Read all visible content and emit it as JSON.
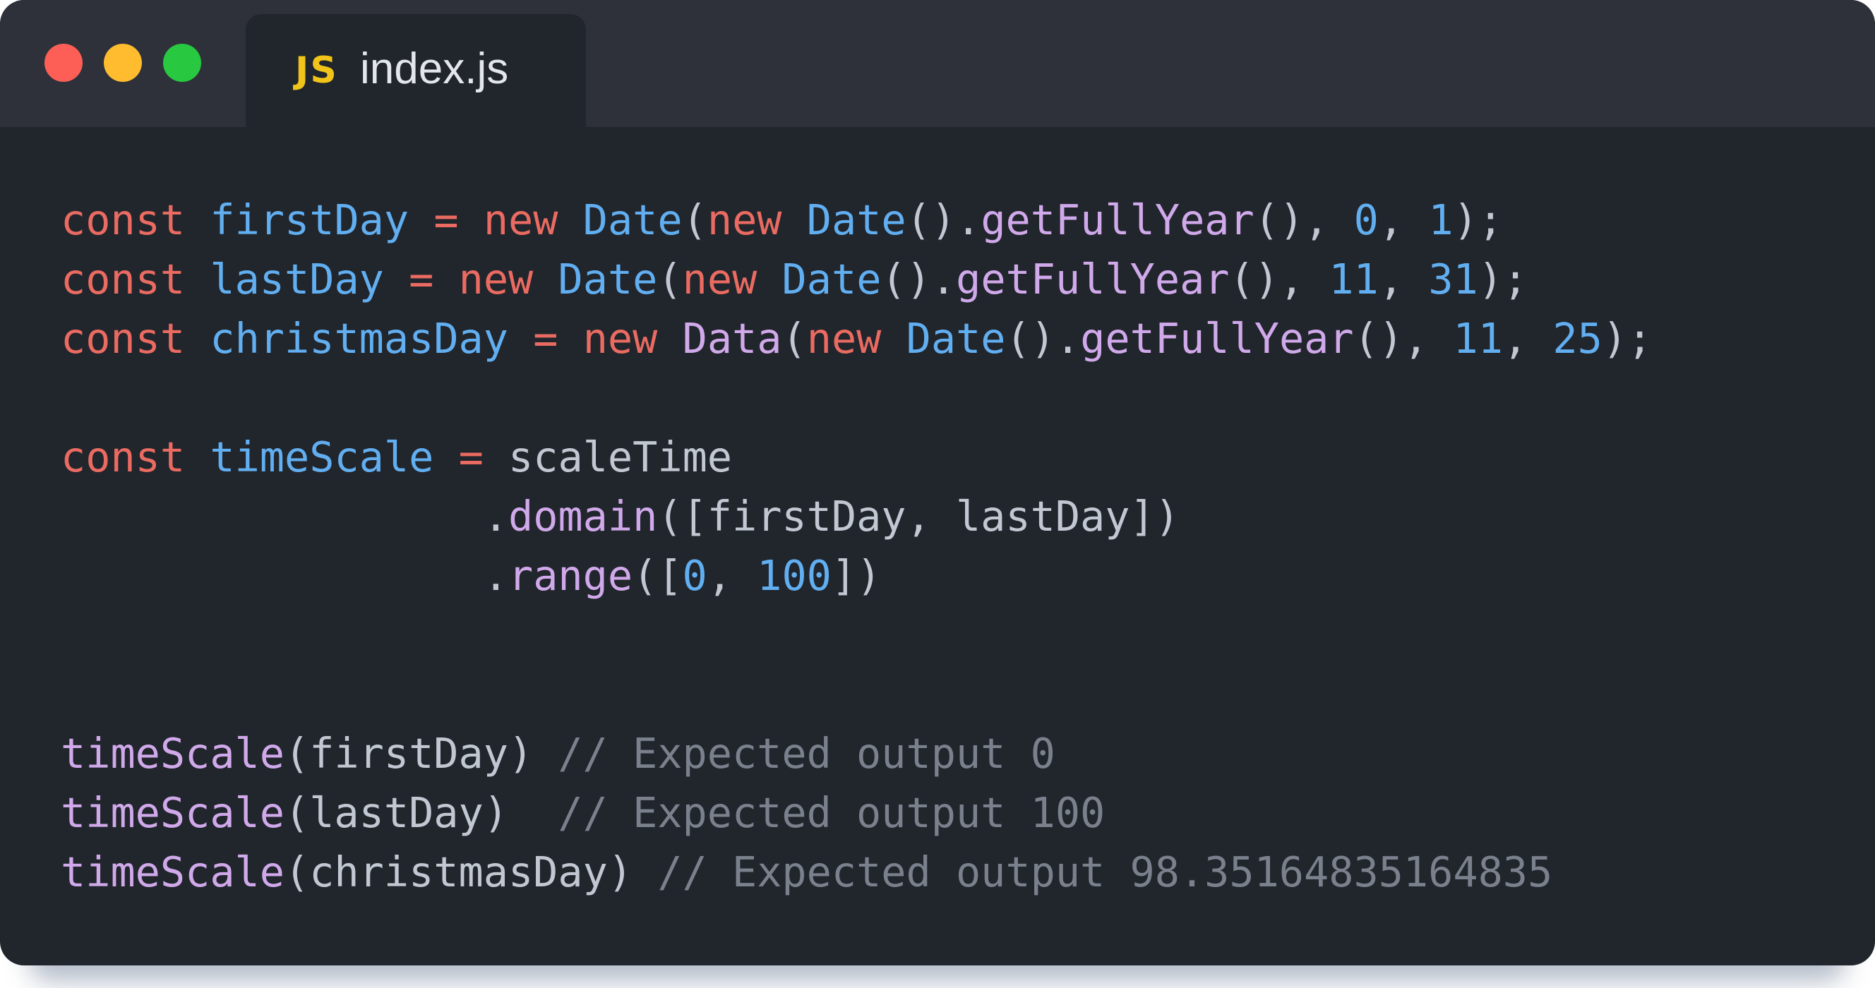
{
  "window": {
    "controls": [
      "close",
      "minimize",
      "maximize"
    ],
    "colors": {
      "close": "#fd5f57",
      "minimize": "#febc2e",
      "maximize": "#28c840"
    }
  },
  "tab": {
    "icon": "JS",
    "filename": "index.js"
  },
  "code": {
    "line1": {
      "kw": "const",
      "name": "firstDay",
      "eq": "=",
      "new1": "new",
      "ctor1": "Date",
      "p1": "(",
      "new2": "new",
      "ctor2": "Date",
      "p2": "().",
      "method": "getFullYear",
      "p3": "(), ",
      "a1": "0",
      "sep": ", ",
      "a2": "1",
      "end": ");"
    },
    "line2": {
      "kw": "const",
      "name": "lastDay",
      "eq": "=",
      "new1": "new",
      "ctor1": "Date",
      "p1": "(",
      "new2": "new",
      "ctor2": "Date",
      "p2": "().",
      "method": "getFullYear",
      "p3": "(), ",
      "a1": "11",
      "sep": ", ",
      "a2": "31",
      "end": ");"
    },
    "line3": {
      "kw": "const",
      "name": "christmasDay",
      "eq": "=",
      "new1": "new",
      "ctor1": "Data",
      "p1": "(",
      "new2": "new",
      "ctor2": "Date",
      "p2": "().",
      "method": "getFullYear",
      "p3": "(), ",
      "a1": "11",
      "sep": ", ",
      "a2": "25",
      "end": ");"
    },
    "line5": {
      "kw": "const",
      "name": "timeScale",
      "eq": "=",
      "value": "scaleTime"
    },
    "line6": {
      "dot": ".",
      "method": "domain",
      "args": "([firstDay, lastDay])"
    },
    "line7": {
      "dot": ".",
      "method": "range",
      "open": "([",
      "a1": "0",
      "sep": ", ",
      "a2": "100",
      "close": "])"
    },
    "line10": {
      "fn": "timeScale",
      "args": "(firstDay)",
      "comment": "// Expected output 0"
    },
    "line11": {
      "fn": "timeScale",
      "args": "(lastDay) ",
      "comment": "// Expected output 100"
    },
    "line12": {
      "fn": "timeScale",
      "args": "(christmasDay)",
      "comment": "// Expected output 98.35164835164835"
    }
  }
}
